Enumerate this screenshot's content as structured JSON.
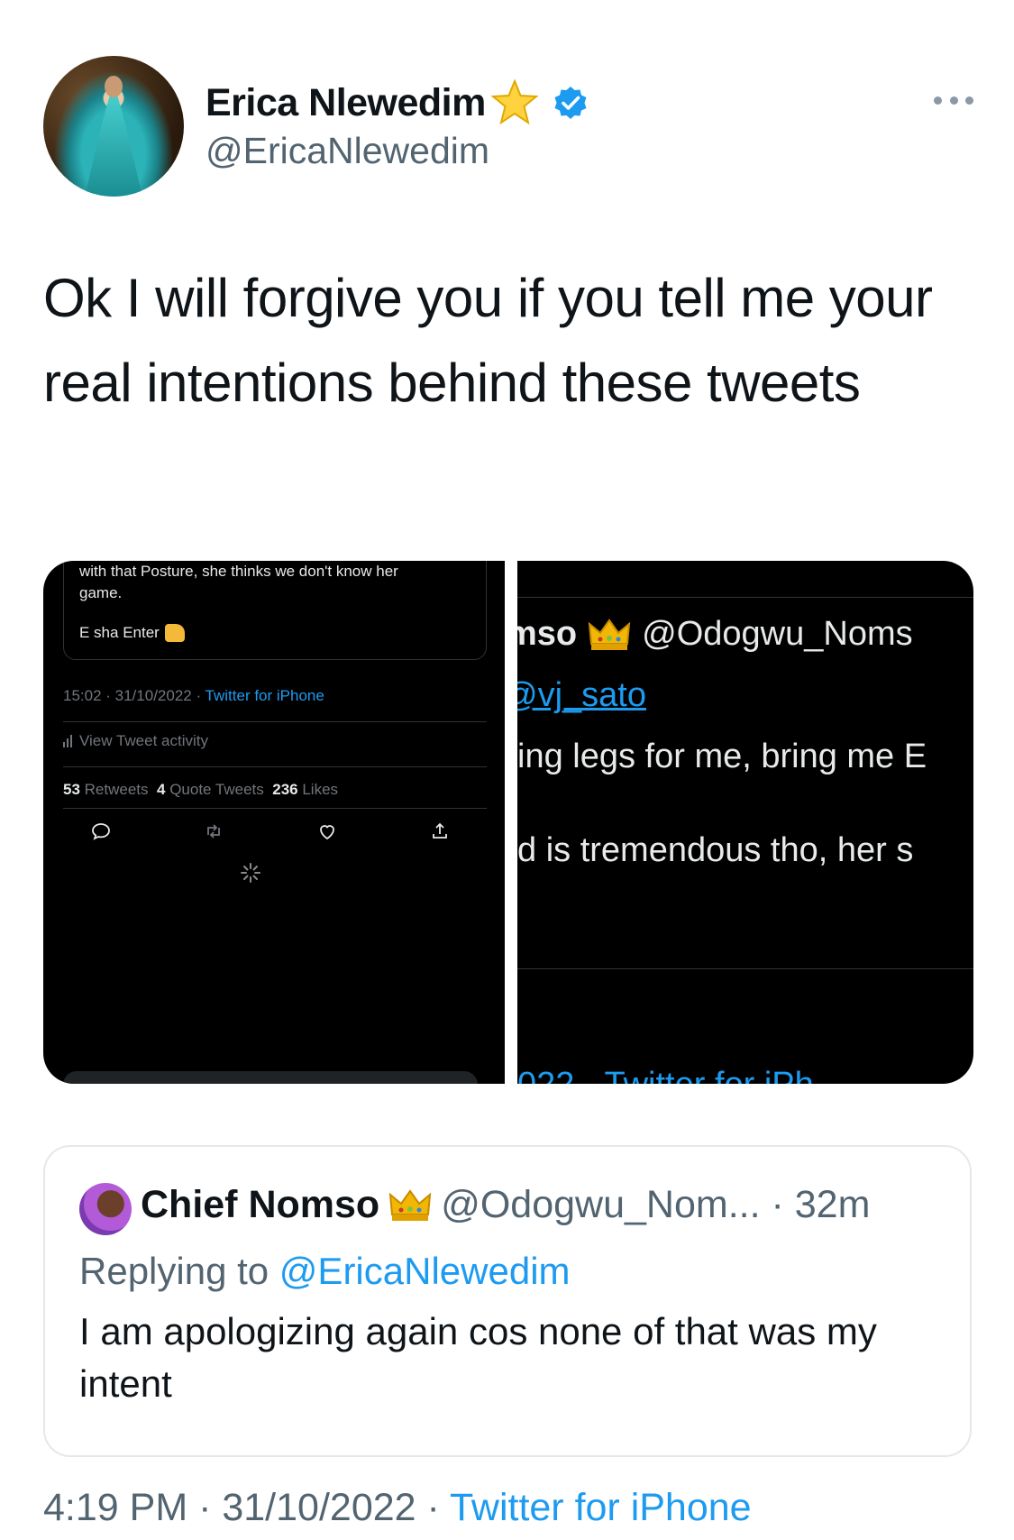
{
  "author": {
    "display_name": "Erica Nlewedim",
    "handle": "@EricaNlewedim",
    "emoji": "star-emoji",
    "verified": true
  },
  "tweet": {
    "text": "Ok I will forgive you if you tell me your real intentions behind these tweets"
  },
  "media": {
    "left": {
      "text_line1": "with that Posture, she thinks we don't know her",
      "text_line2": "game.",
      "text_line3": "E sha Enter",
      "meta_time": "15:02 · 31/10/2022 · ",
      "meta_source": "Twitter for iPhone",
      "activity": "View Tweet activity",
      "retweets_count": "53",
      "retweets_label": "Retweets",
      "quotes_count": "4",
      "quotes_label": "Quote Tweets",
      "likes_count": "236",
      "likes_label": "Likes"
    },
    "right": {
      "name_fragment": "mso",
      "handle_fragment": "@Odogwu_Noms",
      "mention_fragment": "@vj_sato",
      "line1": "ing legs for me, bring me E",
      "line2": "d is tremendous tho, her s",
      "cut_line": "022 · Twitter for iPh"
    }
  },
  "quote": {
    "name": "Chief Nomso",
    "handle_time": "@Odogwu_Nom... · 32m",
    "replying_prefix": "Replying to ",
    "replying_handle": "@EricaNlewedim",
    "text": "I am apologizing again cos none of that was my intent"
  },
  "footer": {
    "time_date": "4:19 PM · 31/10/2022 · ",
    "source": "Twitter for iPhone"
  },
  "colors": {
    "link": "#1d9bf0",
    "secondary_text": "#536471",
    "primary_text": "#0f1419"
  }
}
